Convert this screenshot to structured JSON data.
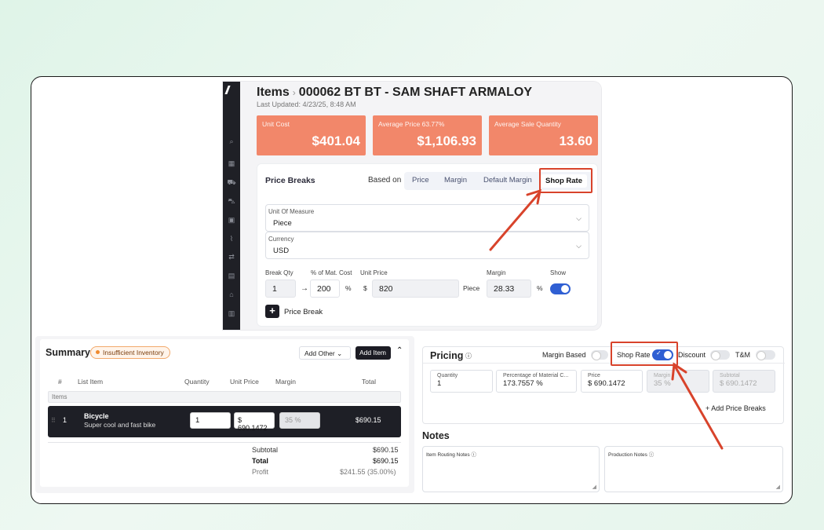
{
  "colors": {
    "accent_red": "#d8432b",
    "card": "#f2876a",
    "toggle_on": "#2f5fd3"
  },
  "header": {
    "section": "Items",
    "item_title": "000062 BT BT - SAM SHAFT ARMALOY",
    "last_updated": "Last Updated: 4/23/25, 8:48 AM"
  },
  "sidebar_icons": [
    "search-icon",
    "grid-icon",
    "cart-icon",
    "truck-icon",
    "calendar-icon",
    "activity-icon",
    "transfer-icon",
    "calculator-icon",
    "storefront-icon",
    "bar-chart-icon"
  ],
  "cards": [
    {
      "label": "Unit Cost",
      "value": "$401.04"
    },
    {
      "label": "Average Price 63.77%",
      "value": "$1,106.93"
    },
    {
      "label": "Average Sale Quantity",
      "value": "13.60"
    }
  ],
  "price_breaks": {
    "heading": "Price Breaks",
    "based_on": "Based on",
    "tabs": [
      "Price",
      "Margin",
      "Default Margin",
      "Shop Rate"
    ],
    "selected_tab": "Shop Rate",
    "uom_label": "Unit Of Measure",
    "uom_value": "Piece",
    "currency_label": "Currency",
    "currency_value": "USD",
    "col_break_qty": "Break Qty",
    "col_pct_mat": "% of Mat. Cost",
    "col_unit_price": "Unit Price",
    "col_margin": "Margin",
    "col_show": "Show",
    "break_qty": "1",
    "arrow": "→",
    "pct_mat": "200",
    "pct_sym": "%",
    "dollar_sym": "$",
    "unit_price": "820",
    "unit": "Piece",
    "margin": "28.33",
    "margin_sym": "%",
    "show_on": true,
    "add_label": "Price Break",
    "add_icon": "+"
  },
  "summary": {
    "heading": "Summary",
    "badge": "Insufficient Inventory",
    "add_other": "Add Other",
    "add_item": "Add Item",
    "columns": {
      "num": "#",
      "item": "List Item",
      "qty": "Quantity",
      "unit_price": "Unit Price",
      "margin": "Margin",
      "total": "Total"
    },
    "items_label": "Items",
    "row": {
      "num": "1",
      "name": "Bicycle",
      "desc": "Super cool and fast bike",
      "qty": "1",
      "price": "$ 690.1472",
      "margin": "35 %",
      "total": "$690.15"
    },
    "subtotal_label": "Subtotal",
    "subtotal": "$690.15",
    "total_label": "Total",
    "total": "$690.15",
    "profit_label": "Profit",
    "profit": "$241.55 (35.00%)"
  },
  "pricing": {
    "heading": "Pricing",
    "info_icon": "ⓘ",
    "margin_based": "Margin Based",
    "shop_rate": "Shop Rate",
    "discount": "Discount",
    "tm": "T&M",
    "fields": [
      {
        "label": "Quantity",
        "value": "1"
      },
      {
        "label": "Percentage of Material C...",
        "value": "173.7557 %"
      },
      {
        "label": "Price",
        "value": "$ 690.1472"
      },
      {
        "label": "Margin",
        "value": "35 %"
      },
      {
        "label": "Subtotal",
        "value": "$ 690.1472"
      }
    ],
    "add_breaks": "+ Add Price Breaks"
  },
  "notes": {
    "heading": "Notes",
    "routing_label": "Item Routing Notes",
    "production_label": "Production Notes"
  }
}
